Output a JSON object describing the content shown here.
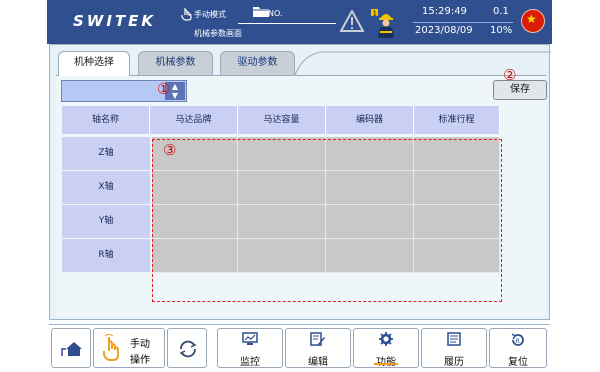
{
  "header": {
    "logo": "SWITEK",
    "mode": "手动模式",
    "program_no": "NO.",
    "screen_name": "机械参数画面",
    "time": "15:29:49",
    "date": "2023/08/09",
    "value_top": "0.1",
    "value_bottom": "10%",
    "icons": [
      "hand-icon",
      "folder-icon",
      "warning-icon",
      "operator-icon",
      "china-flag-icon"
    ]
  },
  "tabs": [
    {
      "label": "机种选择",
      "active": true
    },
    {
      "label": "机械参数",
      "active": false
    },
    {
      "label": "驱动参数",
      "active": false
    }
  ],
  "markers": {
    "m1": "①",
    "m2": "②",
    "m3": "③"
  },
  "selector": {
    "value": ""
  },
  "save_label": "保存",
  "table": {
    "headers": [
      "轴名称",
      "马达品牌",
      "马达容量",
      "编码器",
      "标准行程"
    ],
    "rows": [
      {
        "axis": "Z轴",
        "cells": [
          "",
          "",
          "",
          ""
        ]
      },
      {
        "axis": "X轴",
        "cells": [
          "",
          "",
          "",
          ""
        ]
      },
      {
        "axis": "Y轴",
        "cells": [
          "",
          "",
          "",
          ""
        ]
      },
      {
        "axis": "R轴",
        "cells": [
          "",
          "",
          "",
          ""
        ]
      }
    ]
  },
  "footer": {
    "manual_label_1": "手动",
    "manual_label_2": "操作",
    "buttons": [
      {
        "label": "监控",
        "icon": "monitor-icon"
      },
      {
        "label": "编辑",
        "icon": "edit-icon"
      },
      {
        "label": "功能",
        "icon": "gear-icon",
        "active": true
      },
      {
        "label": "履历",
        "icon": "history-icon"
      },
      {
        "label": "复位",
        "icon": "reset-icon"
      }
    ]
  }
}
